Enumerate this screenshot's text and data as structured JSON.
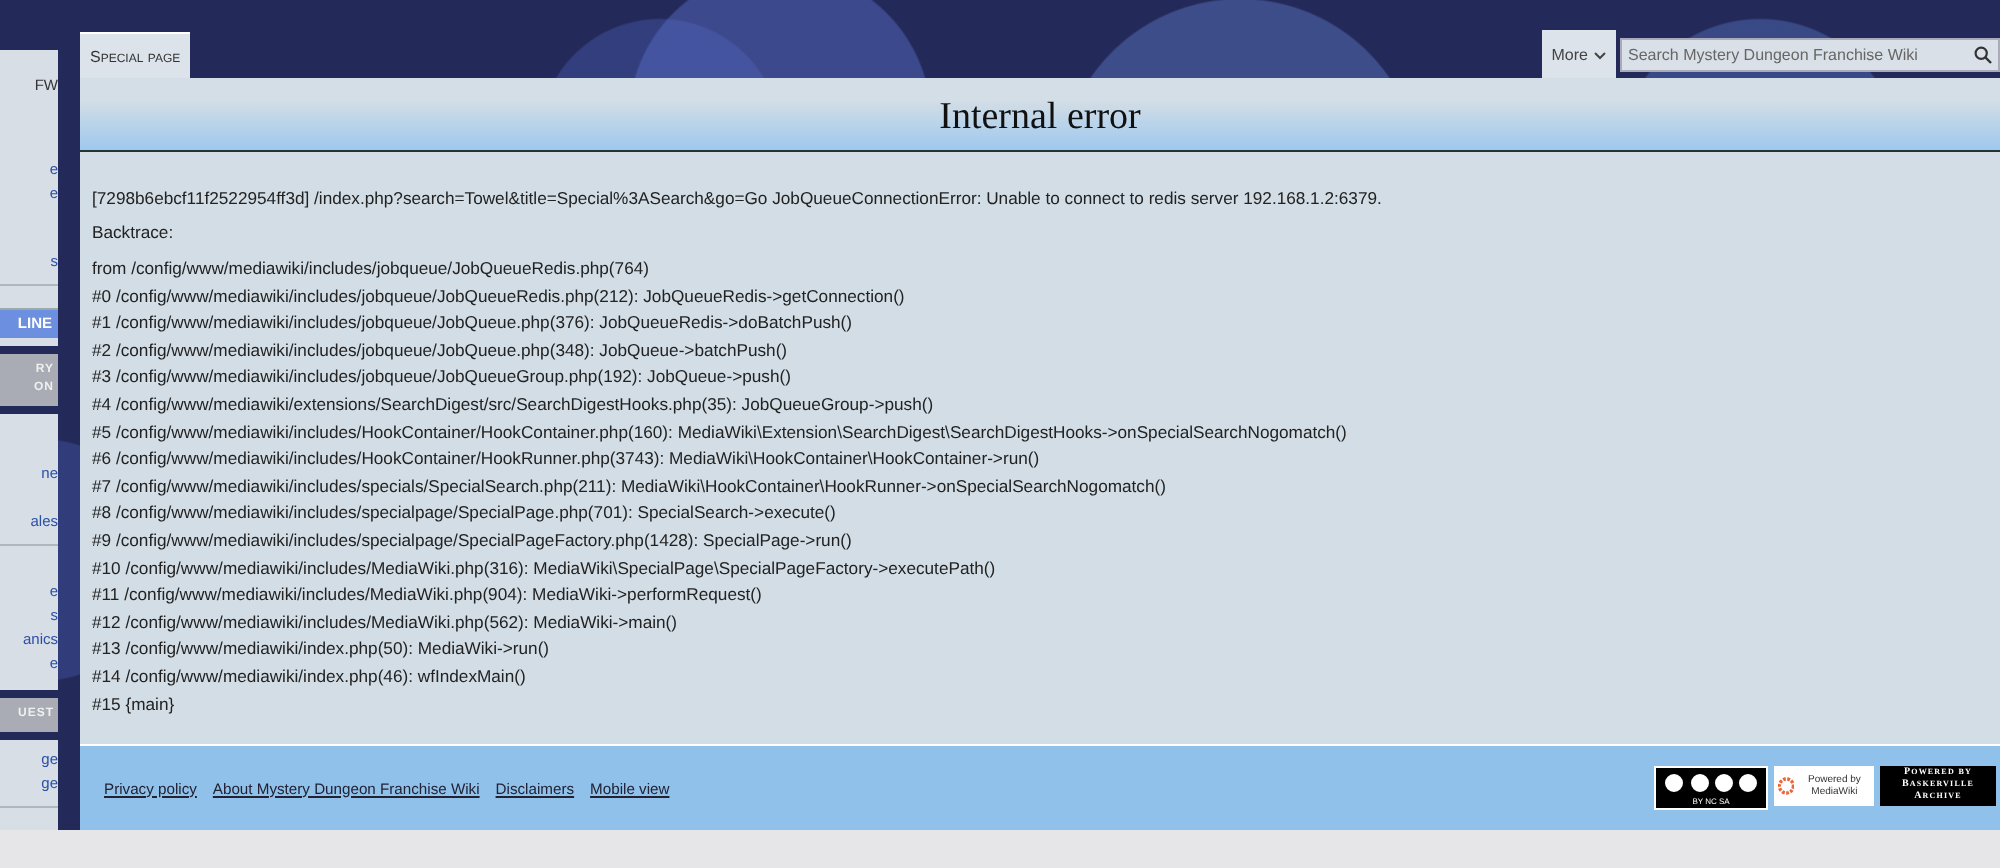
{
  "sidebar": {
    "blocks": [
      {
        "kind": "panel",
        "items": [
          {
            "kind": "title",
            "text": "FW"
          },
          {
            "kind": "link",
            "text": "e"
          },
          {
            "kind": "link",
            "text": "e"
          },
          {
            "kind": "link",
            "text": "s"
          },
          {
            "kind": "button",
            "text": "LINE"
          }
        ]
      },
      {
        "kind": "header",
        "lines": [
          "RY",
          "ON"
        ]
      },
      {
        "kind": "panel",
        "items": [
          {
            "kind": "link",
            "text": "ne"
          },
          {
            "kind": "link",
            "text": "ales"
          },
          {
            "kind": "link",
            "text": "e"
          },
          {
            "kind": "link",
            "text": "s"
          },
          {
            "kind": "link",
            "text": "anics"
          },
          {
            "kind": "link",
            "text": "e"
          }
        ]
      },
      {
        "kind": "header",
        "lines": [
          "UEST"
        ]
      },
      {
        "kind": "panel",
        "items": [
          {
            "kind": "link",
            "text": "ge"
          },
          {
            "kind": "link",
            "text": "ge"
          }
        ]
      }
    ]
  },
  "tabs": [
    {
      "label": "Special page",
      "selected": true
    }
  ],
  "more_menu": {
    "label": "More"
  },
  "search": {
    "placeholder": "Search Mystery Dungeon Franchise Wiki"
  },
  "page": {
    "title": "Internal error",
    "message": "[7298b6ebcf11f2522954ff3d] /index.php?search=Towel&title=Special%3ASearch&go=Go JobQueueConnectionError: Unable to connect to redis server 192.168.1.2:6379.",
    "backtrace_label": "Backtrace:",
    "trace": [
      "from /config/www/mediawiki/includes/jobqueue/JobQueueRedis.php(764)",
      "#0 /config/www/mediawiki/includes/jobqueue/JobQueueRedis.php(212): JobQueueRedis->getConnection()",
      "#1 /config/www/mediawiki/includes/jobqueue/JobQueue.php(376): JobQueueRedis->doBatchPush()",
      "#2 /config/www/mediawiki/includes/jobqueue/JobQueue.php(348): JobQueue->batchPush()",
      "#3 /config/www/mediawiki/includes/jobqueue/JobQueueGroup.php(192): JobQueue->push()",
      "#4 /config/www/mediawiki/extensions/SearchDigest/src/SearchDigestHooks.php(35): JobQueueGroup->push()",
      "#5 /config/www/mediawiki/includes/HookContainer/HookContainer.php(160): MediaWiki\\Extension\\SearchDigest\\SearchDigestHooks->onSpecialSearchNogomatch()",
      "#6 /config/www/mediawiki/includes/HookContainer/HookRunner.php(3743): MediaWiki\\HookContainer\\HookContainer->run()",
      "#7 /config/www/mediawiki/includes/specials/SpecialSearch.php(211): MediaWiki\\HookContainer\\HookRunner->onSpecialSearchNogomatch()",
      "#8 /config/www/mediawiki/includes/specialpage/SpecialPage.php(701): SpecialSearch->execute()",
      "#9 /config/www/mediawiki/includes/specialpage/SpecialPageFactory.php(1428): SpecialPage->run()",
      "#10 /config/www/mediawiki/includes/MediaWiki.php(316): MediaWiki\\SpecialPage\\SpecialPageFactory->executePath()",
      "#11 /config/www/mediawiki/includes/MediaWiki.php(904): MediaWiki->performRequest()",
      "#12 /config/www/mediawiki/includes/MediaWiki.php(562): MediaWiki->main()",
      "#13 /config/www/mediawiki/index.php(50): MediaWiki->run()",
      "#14 /config/www/mediawiki/index.php(46): wfIndexMain()",
      "#15 {main}"
    ]
  },
  "footer": {
    "links": [
      "Privacy policy",
      "About Mystery Dungeon Franchise Wiki",
      "Disclaimers",
      "Mobile view"
    ],
    "badges": [
      {
        "kind": "license",
        "text": "BY NC SA"
      },
      {
        "kind": "mediawiki",
        "text": "Powered by MediaWiki"
      },
      {
        "kind": "archive",
        "lines": [
          "Powered by",
          "Baskerville",
          "Archive"
        ]
      }
    ]
  }
}
